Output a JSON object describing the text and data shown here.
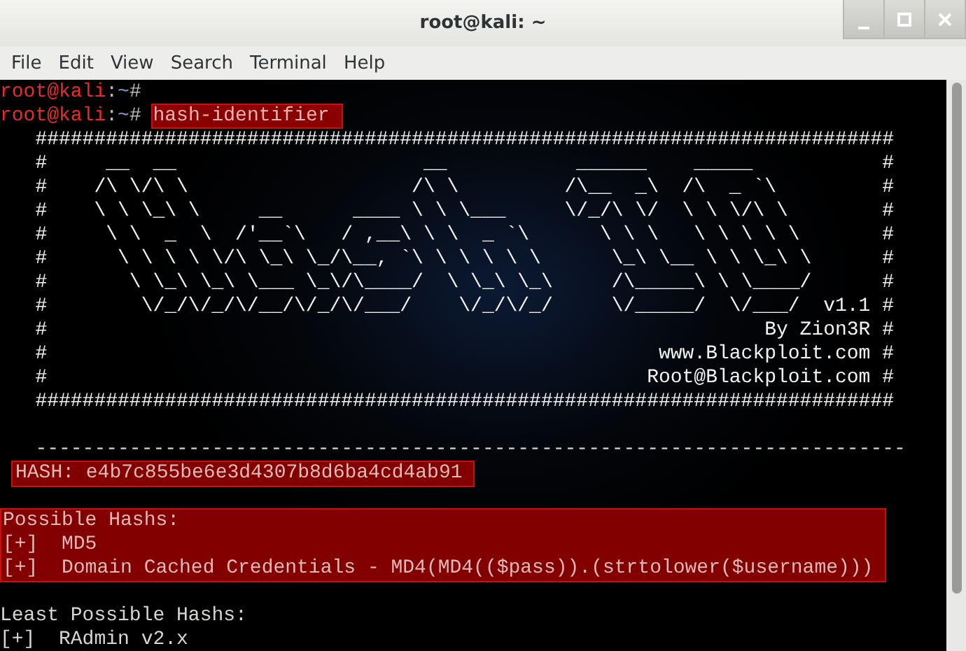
{
  "window": {
    "title": "root@kali: ~"
  },
  "menu": [
    {
      "label": "File"
    },
    {
      "label": "Edit"
    },
    {
      "label": "View"
    },
    {
      "label": "Search"
    },
    {
      "label": "Terminal"
    },
    {
      "label": "Help"
    }
  ],
  "terminal": {
    "segments": [
      {
        "kind": "plain",
        "lines": [
          {
            "kind": "prompt",
            "user": "root@kali",
            "sep": ":",
            "path": "~",
            "symbol": "#"
          },
          {
            "kind": "prompt",
            "user": "root@kali",
            "sep": ":",
            "path": "~",
            "symbol": "#",
            "command": "hash-identifier ",
            "command_selected": true
          },
          {
            "kind": "banner",
            "text": "   #########################################################################"
          },
          {
            "kind": "banner",
            "text": "   #     __  __                     __           ______    _____           #"
          },
          {
            "kind": "banner",
            "text": "   #    /\\ \\/\\ \\                   /\\ \\         /\\__  _\\  /\\  _ `\\         #"
          },
          {
            "kind": "banner",
            "text": "   #    \\ \\ \\_\\ \\     __      ____ \\ \\ \\___     \\/_/\\ \\/  \\ \\ \\/\\ \\        #"
          },
          {
            "kind": "banner",
            "text": "   #     \\ \\  _  \\  /'__`\\   / ,__\\ \\ \\  _ `\\      \\ \\ \\   \\ \\ \\ \\ \\       #"
          },
          {
            "kind": "banner",
            "text": "   #      \\ \\ \\ \\ \\/\\ \\_\\ \\_/\\__, `\\ \\ \\ \\ \\ \\      \\_\\ \\__ \\ \\ \\_\\ \\      #"
          },
          {
            "kind": "banner",
            "text": "   #       \\ \\_\\ \\_\\ \\___ \\_\\/\\____/  \\ \\_\\ \\_\\     /\\_____\\ \\ \\____/      #"
          },
          {
            "kind": "banner",
            "text": "   #        \\/_/\\/_/\\/__/\\/_/\\/___/    \\/_/\\/_/     \\/_____/  \\/___/  v1.1 #"
          },
          {
            "kind": "banner",
            "text": "   #                                                             By Zion3R #"
          },
          {
            "kind": "banner",
            "text": "   #                                                    www.Blackploit.com #"
          },
          {
            "kind": "banner",
            "text": "   #                                                   Root@Blackploit.com #"
          },
          {
            "kind": "banner",
            "text": "   #########################################################################"
          },
          {
            "kind": "blank"
          },
          {
            "kind": "text",
            "text": "   --------------------------------------------------------------------------"
          }
        ]
      },
      {
        "kind": "inline_highlight",
        "lines": [
          {
            "kind": "text",
            "text": "HASH: e4b7c855be6e3d4307b8d6ba4cd4ab91"
          }
        ]
      },
      {
        "kind": "plain",
        "lines": [
          {
            "kind": "blank"
          }
        ]
      },
      {
        "kind": "block_highlight",
        "lines": [
          {
            "kind": "text",
            "text": "Possible Hashs:"
          },
          {
            "kind": "text",
            "text": "[+]  MD5"
          },
          {
            "kind": "text",
            "text": "[+]  Domain Cached Credentials - MD4(MD4(($pass)).(strtolower($username)))"
          }
        ]
      },
      {
        "kind": "plain",
        "lines": [
          {
            "kind": "blank"
          },
          {
            "kind": "text",
            "text": "Least Possible Hashs:"
          },
          {
            "kind": "text",
            "text": "[+]  RAdmin v2.x"
          }
        ]
      }
    ]
  }
}
